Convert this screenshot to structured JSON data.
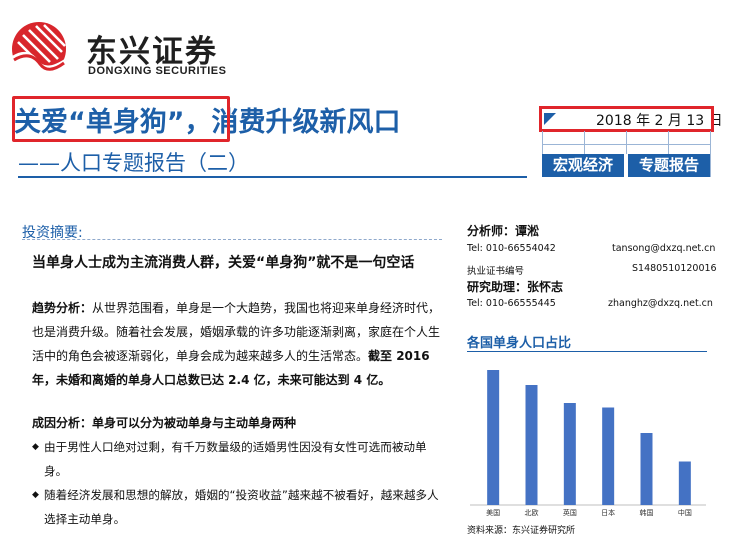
{
  "header": {
    "logo_cn": "东兴证券",
    "logo_en": "DONGXING SECURITIES",
    "title": "关爱“单身狗”，消费升级新风口",
    "subtitle": "——人口专题报告（二）",
    "date": "2018 年 2 月 13 日",
    "tabs": [
      "宏观经济",
      "专题报告"
    ]
  },
  "summary": {
    "heading": "投资摘要:",
    "lead": "当单身人士成为主流消费人群，关爱“单身狗”就不是一句空话",
    "trend_label": "趋势分析：",
    "trend_text": "从世界范围看，单身是一个大趋势，我国也将迎来单身经济时代，也是消费升级。随着社会发展，婚姻承载的许多功能逐渐剥离，家庭在个人生活中的角色会被逐渐弱化，单身会成为越来越多人的生活常态。",
    "trend_bold": "截至 2016 年，未婚和离婚的单身人口总数已达 2.4 亿，未来可能达到 4 亿。",
    "cause_heading": "成因分析：单身可以分为被动单身与主动单身两种",
    "bullets": [
      "由于男性人口绝对过剩，有千万数量级的适婚男性因没有女性可选而被动单身。",
      "随着经济发展和思想的解放，婚姻的“投资收益”越来越不被看好，越来越多人选择主动单身。"
    ]
  },
  "analysts": {
    "a1_label": "分析师：",
    "a1_name": "谭淞",
    "a1_tel": "Tel: 010-66554042",
    "a1_email": "tansong@dxzq.net.cn",
    "a1_cert_label": "执业证书编号",
    "a1_cert": "S1480510120016",
    "a2_label": "研究助理：",
    "a2_name": "张怀志",
    "a2_tel": "Tel: 010-66555445",
    "a2_email": "zhanghz@dxzq.net.cn"
  },
  "chart_data": {
    "type": "bar",
    "title": "各国单身人口占比",
    "categories": [
      "美国",
      "北欧",
      "英国",
      "日本",
      "韩国",
      "中国"
    ],
    "values": [
      45,
      40,
      34,
      32.5,
      24,
      14.5
    ],
    "ylim": [
      0,
      50
    ],
    "bar_color": "#4472c4",
    "source": "资料来源：东兴证券研究所"
  },
  "colors": {
    "brand_blue": "#1d5fa8",
    "highlight_red": "#e0252b",
    "logo_red": "#d8262c"
  }
}
